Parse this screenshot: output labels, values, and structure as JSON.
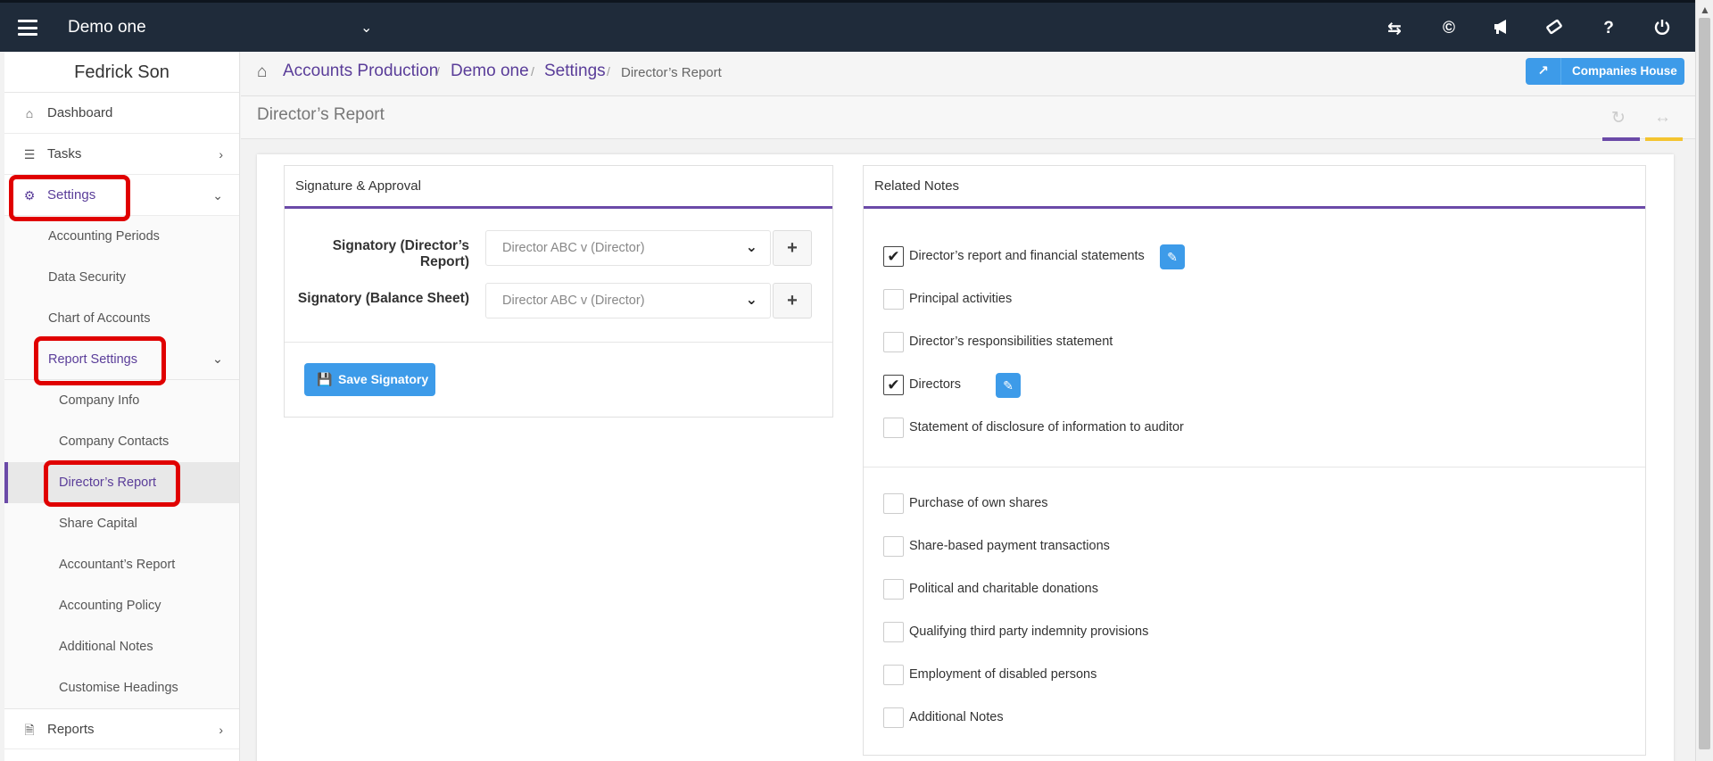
{
  "topbar": {
    "company_name": "Demo one",
    "icons": [
      "transfer-icon",
      "copyright-icon",
      "megaphone-icon",
      "ticket-icon",
      "help-icon",
      "power-icon"
    ]
  },
  "sidebar": {
    "user_name": "Fedrick Son",
    "items": [
      {
        "label": "Dashboard",
        "icon": "home-icon"
      },
      {
        "label": "Tasks",
        "icon": "tasks-icon"
      },
      {
        "label": "Settings",
        "icon": "gear-icon"
      }
    ],
    "settings_sub": [
      "Accounting Periods",
      "Data Security",
      "Chart of Accounts",
      "Report Settings"
    ],
    "report_settings_sub": [
      "Company Info",
      "Company Contacts",
      "Director’s Report",
      "Share Capital",
      "Accountant’s Report",
      "Accounting Policy",
      "Additional Notes",
      "Customise Headings"
    ],
    "reports_label": "Reports"
  },
  "breadcrumb": {
    "items": [
      "Accounts Production",
      "Demo one",
      "Settings"
    ],
    "current": "Director’s Report",
    "companies_house": "Companies House"
  },
  "page": {
    "title": "Director’s Report"
  },
  "signature_panel": {
    "title": "Signature & Approval",
    "fields": [
      {
        "label": "Signatory (Director’s Report)",
        "value": "Director ABC v (Director)"
      },
      {
        "label": "Signatory (Balance Sheet)",
        "value": "Director ABC v (Director)"
      }
    ],
    "save_label": "Save Signatory"
  },
  "notes_panel": {
    "title": "Related Notes",
    "group1": [
      {
        "label": "Director’s report and financial statements",
        "checked": true,
        "editable": true
      },
      {
        "label": "Principal activities",
        "checked": false,
        "editable": false
      },
      {
        "label": "Director’s responsibilities statement",
        "checked": false,
        "editable": false
      },
      {
        "label": "Directors",
        "checked": true,
        "editable": true
      },
      {
        "label": "Statement of disclosure of information to auditor",
        "checked": false,
        "editable": false
      }
    ],
    "group2": [
      {
        "label": "Purchase of own shares",
        "checked": false
      },
      {
        "label": "Share-based payment transactions",
        "checked": false
      },
      {
        "label": "Political and charitable donations",
        "checked": false
      },
      {
        "label": "Qualifying third party indemnity provisions",
        "checked": false
      },
      {
        "label": "Employment of disabled persons",
        "checked": false
      },
      {
        "label": "Additional Notes",
        "checked": false
      }
    ]
  },
  "colors": {
    "accent": "#6b4aa8",
    "primary_button": "#3d9be9",
    "topbar": "#1f2b3a",
    "highlight": "#e00000"
  }
}
